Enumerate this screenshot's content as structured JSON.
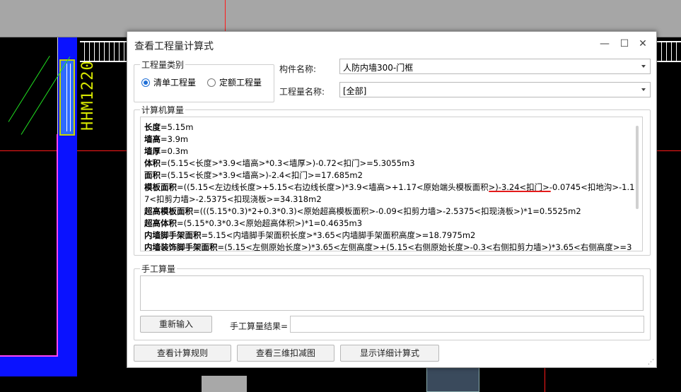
{
  "background": {
    "cad_label": "HHM1220"
  },
  "dialog": {
    "title": "查看工程量计算式",
    "controls": {
      "minimize": "—",
      "maximize": "☐",
      "close": "✕"
    },
    "category_group": {
      "title": "工程量类别",
      "options": [
        {
          "label": "清单工程量",
          "selected": true
        },
        {
          "label": "定额工程量",
          "selected": false
        }
      ]
    },
    "component": {
      "label": "构件名称:",
      "value": "人防内墙300-门框"
    },
    "quantity": {
      "label": "工程量名称:",
      "value": "[全部]"
    },
    "computer_group": {
      "title": "计算机算量",
      "lines": [
        {
          "name": "长度",
          "expr": "=5.15m"
        },
        {
          "name": "墙高",
          "expr": "=3.9m"
        },
        {
          "name": "墙厚",
          "expr": "=0.3m"
        },
        {
          "name": "体积",
          "expr": "=(5.15<长度>*3.9<墙高>*0.3<墙厚>)-0.72<扣门>=5.3055m3"
        },
        {
          "name": "面积",
          "expr": "=(5.15<长度>*3.9<墙高>)-2.4<扣门>=17.685m2"
        },
        {
          "name": "模板面积",
          "expr": "=((5.15<左边线长度>+5.15<右边线长度>)*3.9<墙高>+1.17<原始端头模板面积>)-3.24<扣门>-0.0745<扣地沟>-1.1"
        },
        {
          "name": "",
          "expr": "7<扣剪力墙>-2.5375<扣现浇板>=34.318m2"
        },
        {
          "name": "超高模板面积",
          "expr": "=(((5.15*0.3)*2+0.3*0.3)<原始超高模板面积>-0.09<扣剪力墙>-2.5375<扣现浇板>)*1=0.5525m2"
        },
        {
          "name": "超高体积",
          "expr": "=(5.15*0.3*0.3<原始超高体积>)*1=0.4635m3"
        },
        {
          "name": "内墙脚手架面积",
          "expr": "=5.15<内墙脚手架面积长度>*3.65<内墙脚手架面积高度>=18.7975m2"
        },
        {
          "name": "内墙装饰脚手架面积",
          "expr": "=(5.15<左侧原始长度>)*3.65<左侧高度>+(5.15<右侧原始长度>-0.3<右侧扣剪力墙>)*3.65<右侧高度>=3"
        }
      ]
    },
    "manual_group": {
      "title": "手工算量",
      "reenter_button": "重新输入",
      "result_label": "手工算量结果=",
      "result_value": ""
    },
    "footer_buttons": {
      "rules": "查看计算规则",
      "view3d": "查看三维扣减图",
      "details": "显示详细计算式"
    },
    "colors": {
      "accent": "#1f6fd6",
      "annotation": "#e41b1b"
    }
  }
}
